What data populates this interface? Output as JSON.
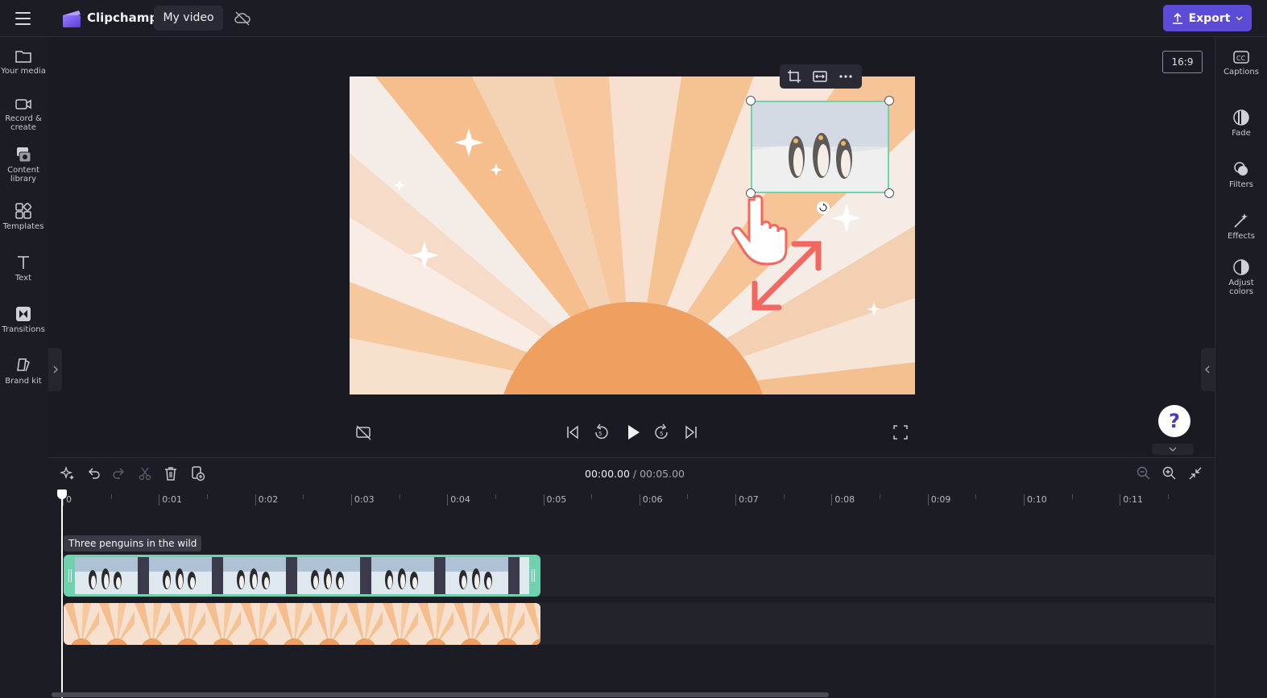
{
  "app": {
    "name": "Clipchamp",
    "video_name": "My video"
  },
  "header": {
    "export_label": "Export"
  },
  "left_rail": [
    {
      "id": "your-media",
      "lines": [
        "Your media"
      ]
    },
    {
      "id": "record-create",
      "lines": [
        "Record &",
        "create"
      ]
    },
    {
      "id": "content-library",
      "lines": [
        "Content",
        "library"
      ]
    },
    {
      "id": "templates",
      "lines": [
        "Templates"
      ]
    },
    {
      "id": "text",
      "lines": [
        "Text"
      ]
    },
    {
      "id": "transitions",
      "lines": [
        "Transitions"
      ]
    },
    {
      "id": "brand-kit",
      "lines": [
        "Brand kit"
      ]
    }
  ],
  "right_rail": [
    {
      "id": "captions",
      "lines": [
        "Captions"
      ]
    },
    {
      "id": "fade",
      "lines": [
        "Fade"
      ]
    },
    {
      "id": "filters",
      "lines": [
        "Filters"
      ]
    },
    {
      "id": "effects",
      "lines": [
        "Effects"
      ]
    },
    {
      "id": "adjust-colors",
      "lines": [
        "Adjust",
        "colors"
      ]
    }
  ],
  "preview": {
    "aspect_ratio": "16:9",
    "help_label": "?"
  },
  "timeline": {
    "current_time": "00:00.00",
    "separator": " / ",
    "duration": "00:05.00",
    "ruler": [
      "0",
      "0:01",
      "0:02",
      "0:03",
      "0:04",
      "0:05",
      "0:06",
      "0:07",
      "0:08",
      "0:09",
      "0:10",
      "0:11"
    ],
    "clip_label": "Three penguins in the wild"
  },
  "colors": {
    "accent": "#5b4bd6",
    "clip_border": "#6fd2ae",
    "sunburst_light": "#f7e4d6",
    "sunburst_dark": "#f5be8c",
    "sun": "#efa060",
    "arrow": "#f2675f"
  }
}
